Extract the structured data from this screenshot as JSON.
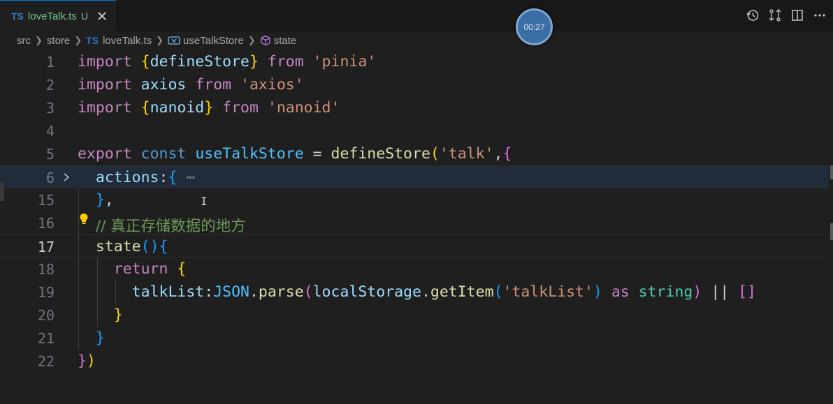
{
  "tab": {
    "lang_badge": "TS",
    "file_name": "loveTalk.ts",
    "status": "U"
  },
  "timer": {
    "text": "00:27"
  },
  "breadcrumb": {
    "items": [
      "src",
      "store",
      "loveTalk.ts",
      "useTalkStore",
      "state"
    ],
    "lang_badge": "TS"
  },
  "toolbar": {
    "icons": [
      "history-icon",
      "compare-changes-icon",
      "split-editor-icon",
      "more-actions-icon"
    ]
  },
  "editor": {
    "line_numbers": [
      "1",
      "2",
      "3",
      "4",
      "5",
      "6",
      "15",
      "16",
      "17",
      "18",
      "19",
      "20",
      "21",
      "22"
    ],
    "active_line": "17",
    "lines": [
      [
        "import",
        " ",
        "{",
        "defineStore",
        "}",
        " ",
        "from",
        " ",
        "'pinia'"
      ],
      [
        "import",
        " ",
        "axios",
        " ",
        "from",
        " ",
        "'axios'"
      ],
      [
        "import",
        " ",
        "{",
        "nanoid",
        "}",
        " ",
        "from",
        " ",
        "'nanoid'"
      ],
      [],
      [
        "export",
        " ",
        "const",
        " ",
        "useTalkStore",
        " = ",
        "defineStore",
        "(",
        "'talk'",
        ",",
        "{"
      ],
      [
        "  ",
        "actions",
        ":",
        "{",
        " ",
        "⋯"
      ],
      [
        "  ",
        "}",
        ","
      ],
      [
        "  ",
        "// 真正存储数据的地方"
      ],
      [
        "  ",
        "state",
        "(",
        ")",
        "{"
      ],
      [
        "    ",
        "return",
        " ",
        "{"
      ],
      [
        "      ",
        "talkList",
        ":",
        "JSON",
        ".",
        "parse",
        "(",
        "localStorage",
        ".",
        "getItem",
        "(",
        "'talkList'",
        ")",
        " ",
        "as",
        " ",
        "string",
        ")",
        " ",
        "||",
        " ",
        "[",
        "]"
      ],
      [
        "    ",
        "}"
      ],
      [
        "  ",
        "}"
      ],
      [
        "}",
        ")"
      ]
    ]
  }
}
